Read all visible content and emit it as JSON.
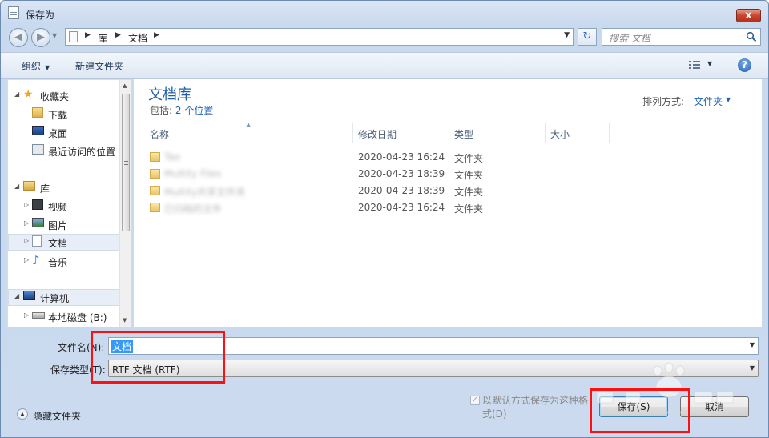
{
  "window": {
    "title": "保存为",
    "close_glyph": "x"
  },
  "nav": {
    "back_glyph": "◀",
    "forward_glyph": "▶",
    "breadcrumb": [
      "库",
      "文档"
    ],
    "search_placeholder": "搜索 文档"
  },
  "toolbar": {
    "organize_label": "组织",
    "new_folder_label": "新建文件夹",
    "help_glyph": "?"
  },
  "sidebar": {
    "items": [
      {
        "label": "收藏夹",
        "icon": "star-icon"
      },
      {
        "label": "下载",
        "icon": "download-folder-icon"
      },
      {
        "label": "桌面",
        "icon": "desktop-icon"
      },
      {
        "label": "最近访问的位置",
        "icon": "recent-places-icon"
      },
      {
        "label": "库",
        "icon": "libraries-icon"
      },
      {
        "label": "视频",
        "icon": "video-icon"
      },
      {
        "label": "图片",
        "icon": "pictures-icon"
      },
      {
        "label": "文档",
        "icon": "documents-icon"
      },
      {
        "label": "音乐",
        "icon": "music-icon"
      },
      {
        "label": "计算机",
        "icon": "computer-icon"
      },
      {
        "label": "本地磁盘 (B:)",
        "icon": "drive-icon"
      }
    ]
  },
  "library": {
    "title": "文档库",
    "includes_label": "包括:",
    "locations_link": "2 个位置",
    "arrange_label": "排列方式:",
    "arrange_value": "文件夹"
  },
  "columns": [
    "名称",
    "修改日期",
    "类型",
    "大小"
  ],
  "files": [
    {
      "name": "Tao",
      "date": "2020-04-23 16:24",
      "type": "文件夹"
    },
    {
      "name": "Multity Files",
      "date": "2020-04-23 18:39",
      "type": "文件夹"
    },
    {
      "name": "Multity共享文件夹",
      "date": "2020-04-23 18:39",
      "type": "文件夹"
    },
    {
      "name": "已归档的文件",
      "date": "2020-04-23 16:24",
      "type": "文件夹"
    }
  ],
  "form": {
    "filename_label": "文件名(N):",
    "filename_value": "文档",
    "filetype_label": "保存类型(T):",
    "filetype_value": "RTF 文档 (RTF)",
    "default_format_label": "以默认方式保存为这种格式(D)",
    "hide_folders_label": "隐藏文件夹",
    "save_label": "保存(S)",
    "cancel_label": "取消"
  },
  "colors": {
    "accent": "#1f63b5",
    "highlight": "#ff1010",
    "selection": "#3399ff"
  }
}
